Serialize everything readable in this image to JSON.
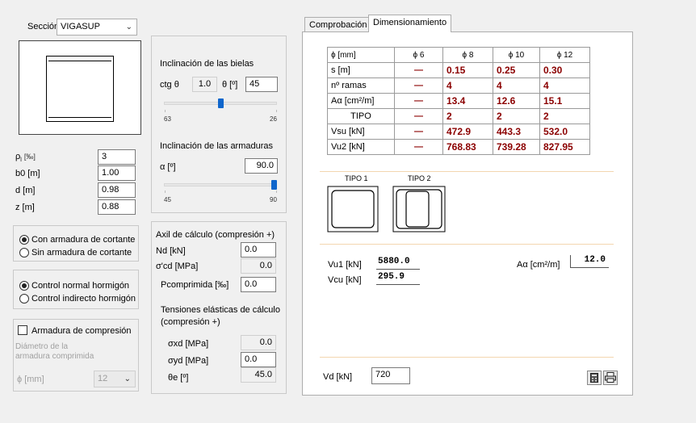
{
  "seccion": {
    "label": "Sección",
    "value": "VIGASUP"
  },
  "section_params": {
    "rows": [
      {
        "label": "ρ",
        "sub": "l",
        "unit": "[‰]",
        "value": "3"
      },
      {
        "label": "b0 [m]",
        "value": "1.00"
      },
      {
        "label": "d [m]",
        "value": "0.98"
      },
      {
        "label": "z [m]",
        "value": "0.88"
      }
    ]
  },
  "bielas": {
    "title": "Inclinación de las bielas",
    "ctg_label": "ctg θ",
    "ctg_value": "1.0",
    "theta_label": "θ [º]",
    "theta_value": "45",
    "slider_min": "63",
    "slider_max": "26",
    "slider_fraction": 0.5
  },
  "armaduras": {
    "title": "Inclinación de las armaduras",
    "alpha_label": "α [º]",
    "alpha_value": "90.0",
    "slider_min": "45",
    "slider_max": "90",
    "slider_fraction": 1.0
  },
  "cortante": {
    "options": [
      "Con armadura de cortante",
      "Sin armadura de cortante"
    ],
    "selected": 0
  },
  "control": {
    "options": [
      "Control normal hormigón",
      "Control indirecto hormigón"
    ],
    "selected": 0
  },
  "compresion": {
    "checkbox_label": "Armadura de compresión",
    "diam_label_1": "Diámetro de la",
    "diam_label_2": "armadura comprimida",
    "phi_label": "ϕ [mm]",
    "phi_value": "12"
  },
  "axil": {
    "title": "Axil de cálculo (compresión +)",
    "nd_label": "Nd [kN]",
    "nd_value": "0.0",
    "scd_label": "σ'cd [MPa]",
    "scd_value": "0.0",
    "pcomp_label": "Pcomprimida [‰]",
    "pcomp_value": "0.0",
    "tens_title_1": "Tensiones elásticas de cálculo",
    "tens_title_2": "(compresión +)",
    "sxd_label": "σxd [MPa]",
    "sxd_value": "0.0",
    "syd_label": "σyd [MPa]",
    "syd_value": "0.0",
    "te_label": "θe [º]",
    "te_value": "45.0"
  },
  "tabs": [
    "Comprobación",
    "Dimensionamiento"
  ],
  "dim_table": {
    "header": [
      "ϕ  [mm]",
      "ϕ 6",
      "ϕ 8",
      "ϕ 10",
      "ϕ 12"
    ],
    "rows": [
      {
        "label": "s [m]",
        "values": [
          "—",
          "0.15",
          "0.25",
          "0.30"
        ]
      },
      {
        "label": "nº ramas",
        "values": [
          "—",
          "4",
          "4",
          "4"
        ]
      },
      {
        "label": "Aα [cm²/m]",
        "values": [
          "—",
          "13.4",
          "12.6",
          "15.1"
        ]
      },
      {
        "label": "TIPO",
        "values": [
          "—",
          "2",
          "2",
          "2"
        ]
      },
      {
        "label": "Vsu [kN]",
        "values": [
          "—",
          "472.9",
          "443.3",
          "532.0"
        ]
      },
      {
        "label": "Vu2 [kN]",
        "values": [
          "—",
          "768.83",
          "739.28",
          "827.95"
        ]
      }
    ]
  },
  "tipos": [
    "TIPO 1",
    "TIPO 2"
  ],
  "results": {
    "vu1_label": "Vu1 [kN]",
    "vu1_value": "5880.0",
    "vcu_label": "Vcu [kN]",
    "vcu_value": "295.9",
    "aa_label": "Aα [cm²/m]",
    "aa_value": "12.0"
  },
  "vd": {
    "label": "Vd [kN]",
    "value": "720"
  },
  "icons": [
    "calculator-icon",
    "printer-icon"
  ]
}
